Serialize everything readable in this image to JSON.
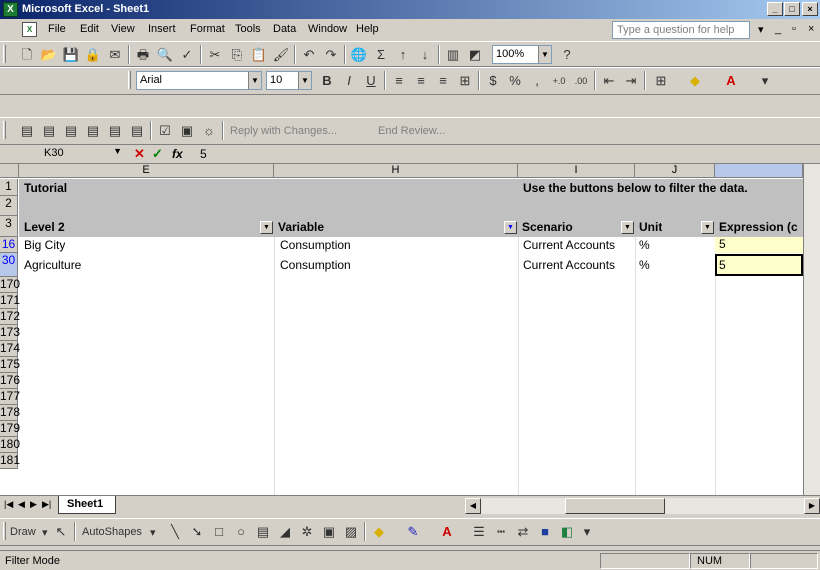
{
  "window": {
    "title": "Microsoft Excel - Sheet1",
    "min": "_",
    "max": "□",
    "close": "×"
  },
  "menu": {
    "items": [
      "File",
      "Edit",
      "View",
      "Insert",
      "Format",
      "Tools",
      "Data",
      "Window",
      "Help"
    ],
    "help_placeholder": "Type a question for help"
  },
  "toolbar": {
    "zoom": "100%",
    "font": "Arial",
    "font_size": "10",
    "reply_label": "Reply with Changes...",
    "end_review_label": "End Review..."
  },
  "formula_bar": {
    "name_box": "K30",
    "formula": "5"
  },
  "grid": {
    "columns": [
      "E",
      "H",
      "I",
      "J",
      ""
    ],
    "row_headers": [
      "1",
      "2",
      "3",
      "16",
      "30",
      "170",
      "171",
      "172",
      "173",
      "174",
      "175",
      "176",
      "177",
      "178",
      "179",
      "180",
      "181"
    ],
    "title": "Tutorial",
    "instruction": "Use the buttons below to filter the data.",
    "headers": [
      "Level 2",
      "Variable",
      "Scenario",
      "Unit",
      "Expression (c"
    ],
    "rows": [
      {
        "level": "Big City",
        "variable": "Consumption",
        "scenario": "Current Accounts",
        "unit": "%",
        "value": "5"
      },
      {
        "level": "Agriculture",
        "variable": "Consumption",
        "scenario": "Current Accounts",
        "unit": "%",
        "value": "5"
      }
    ]
  },
  "sheets": {
    "active": "Sheet1"
  },
  "draw_toolbar": {
    "draw": "Draw",
    "autoshapes": "AutoShapes"
  },
  "status": {
    "mode": "Filter Mode",
    "num": "NUM"
  },
  "colors": {
    "title_gradient_start": "#0a246a",
    "header_band": "#c0c0c0",
    "active_cell": "#ffffcc",
    "blue_row": "#0000ff"
  }
}
